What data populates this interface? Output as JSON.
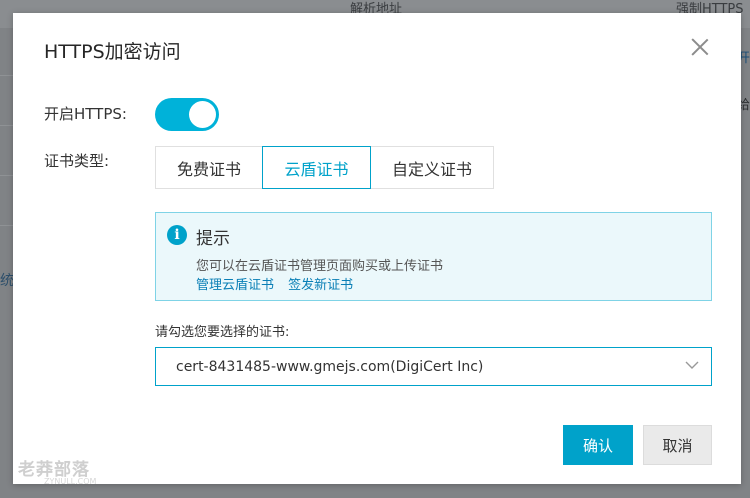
{
  "background": {
    "col_address": "解析地址",
    "col_force": "强制HTTPS",
    "side_text": "统",
    "right_link": "开",
    "right_text": "给"
  },
  "dialog": {
    "title": "HTTPS加密访问",
    "https_label": "开启HTTPS:",
    "https_enabled": true,
    "cert_type_label": "证书类型:",
    "cert_tabs": [
      {
        "label": "免费证书",
        "active": false
      },
      {
        "label": "云盾证书",
        "active": true
      },
      {
        "label": "自定义证书",
        "active": false
      }
    ],
    "notice": {
      "title": "提示",
      "text": "您可以在云盾证书管理页面购买或上传证书",
      "link_manage": "管理云盾证书",
      "link_issue": "签发新证书"
    },
    "select_label": "请勾选您要选择的证书:",
    "selected_cert": "cert-8431485-www.gmejs.com(DigiCert Inc)",
    "ok_label": "确认",
    "cancel_label": "取消"
  },
  "watermark": {
    "text": "老莽部落",
    "sub": "ZYNULL.COM"
  },
  "colors": {
    "accent": "#00a2ca",
    "toggle_on": "#00b2d9",
    "notice_bg": "#ebf8fb",
    "notice_border": "#7fd3e6"
  }
}
